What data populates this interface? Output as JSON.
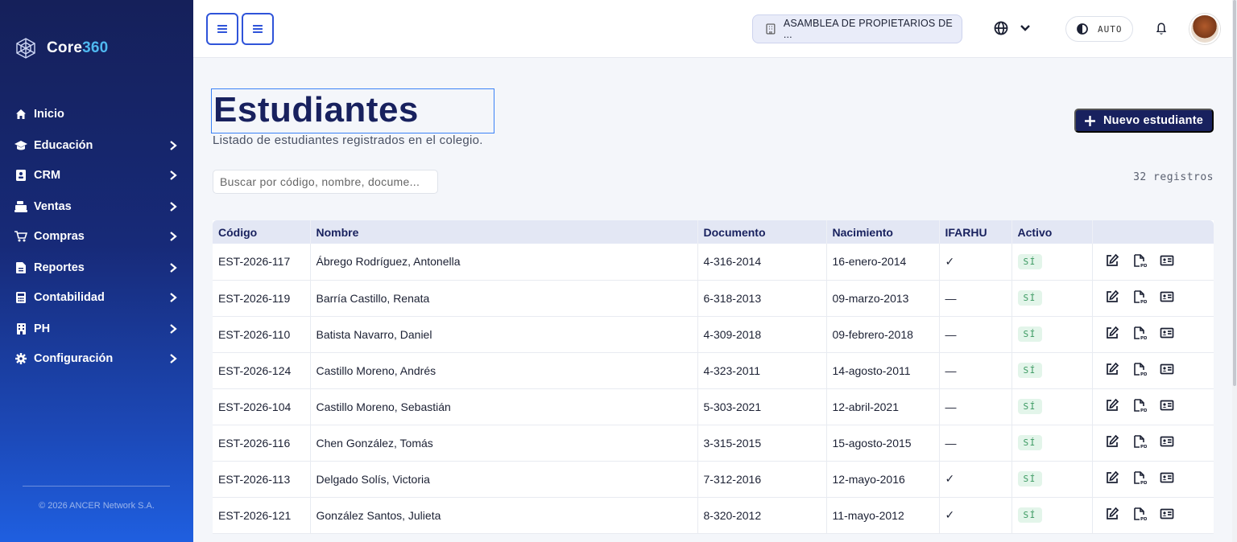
{
  "sidebar": {
    "brand": {
      "name_main": "Core",
      "name_accent": "360"
    },
    "items": [
      {
        "label": "Inicio",
        "icon": "home-icon",
        "has_children": false
      },
      {
        "label": "Educación",
        "icon": "graduation-cap-icon",
        "has_children": true
      },
      {
        "label": "CRM",
        "icon": "contact-card-icon",
        "has_children": true
      },
      {
        "label": "Ventas",
        "icon": "cash-register-icon",
        "has_children": true
      },
      {
        "label": "Compras",
        "icon": "cart-icon",
        "has_children": true
      },
      {
        "label": "Reportes",
        "icon": "report-file-icon",
        "has_children": true
      },
      {
        "label": "Contabilidad",
        "icon": "calculator-icon",
        "has_children": true
      },
      {
        "label": "PH",
        "icon": "building-icon",
        "has_children": true
      },
      {
        "label": "Configuración",
        "icon": "gear-icon",
        "has_children": true
      }
    ],
    "copyright": "© 2026 ANCER Network S.A."
  },
  "topbar": {
    "organization": "ASAMBLEA DE PROPIETARIOS DE ...",
    "theme_label": "AUTO"
  },
  "page": {
    "title": "Estudiantes",
    "subtitle": "Listado de estudiantes registrados en el colegio.",
    "new_button": "Nuevo estudiante",
    "search_placeholder": "Buscar por código, nombre, docume...",
    "record_count": "32 registros"
  },
  "table": {
    "columns": [
      "Código",
      "Nombre",
      "Documento",
      "Nacimiento",
      "IFARHU",
      "Activo",
      ""
    ],
    "rows": [
      {
        "codigo": "EST-2026-117",
        "nombre": "Ábrego Rodríguez, Antonella",
        "documento": "4-316-2014",
        "nacimiento": "16-enero-2014",
        "ifarhu": "✓",
        "activo": "SÍ"
      },
      {
        "codigo": "EST-2026-119",
        "nombre": "Barría Castillo, Renata",
        "documento": "6-318-2013",
        "nacimiento": "09-marzo-2013",
        "ifarhu": "—",
        "activo": "SÍ"
      },
      {
        "codigo": "EST-2026-110",
        "nombre": "Batista Navarro, Daniel",
        "documento": "4-309-2018",
        "nacimiento": "09-febrero-2018",
        "ifarhu": "—",
        "activo": "SÍ"
      },
      {
        "codigo": "EST-2026-124",
        "nombre": "Castillo Moreno, Andrés",
        "documento": "4-323-2011",
        "nacimiento": "14-agosto-2011",
        "ifarhu": "—",
        "activo": "SÍ"
      },
      {
        "codigo": "EST-2026-104",
        "nombre": "Castillo Moreno, Sebastián",
        "documento": "5-303-2021",
        "nacimiento": "12-abril-2021",
        "ifarhu": "—",
        "activo": "SÍ"
      },
      {
        "codigo": "EST-2026-116",
        "nombre": "Chen González, Tomás",
        "documento": "3-315-2015",
        "nacimiento": "15-agosto-2015",
        "ifarhu": "—",
        "activo": "SÍ"
      },
      {
        "codigo": "EST-2026-113",
        "nombre": "Delgado Solís, Victoria",
        "documento": "7-312-2016",
        "nacimiento": "12-mayo-2016",
        "ifarhu": "✓",
        "activo": "SÍ"
      },
      {
        "codigo": "EST-2026-121",
        "nombre": "González Santos, Julieta",
        "documento": "8-320-2012",
        "nacimiento": "11-mayo-2012",
        "ifarhu": "✓",
        "activo": "SÍ"
      }
    ]
  }
}
